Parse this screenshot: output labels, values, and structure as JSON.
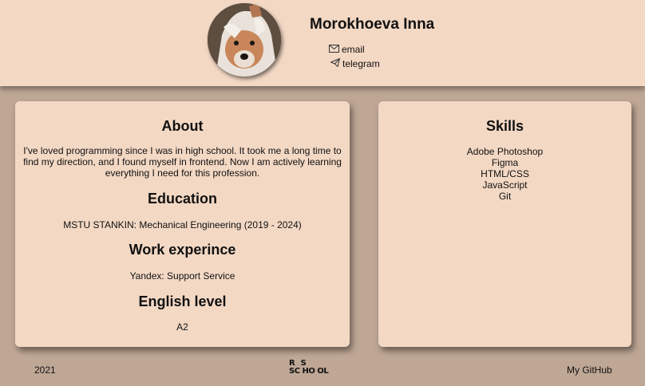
{
  "header": {
    "name": "Morokhoeva Inna",
    "email_label": "email",
    "telegram_label": "telegram"
  },
  "about": {
    "title": "About",
    "text": "I've loved programming since I was in high school. It took me a long time to find my direction, and I found myself in frontend. Now I am actively learning everything I need for this profession."
  },
  "education": {
    "title": "Education",
    "text": "MSTU STANKIN: Mechanical Engineering (2019 - 2024)"
  },
  "work": {
    "title": "Work experince",
    "text": "Yandex: Support Service"
  },
  "english": {
    "title": "English level",
    "text": "A2"
  },
  "skills": {
    "title": "Skills",
    "items": [
      "Adobe Photoshop",
      "Figma",
      "HTML/CSS",
      "JavaScript",
      "Git"
    ]
  },
  "footer": {
    "year": "2021",
    "logo_line1": "R  S",
    "logo_line2": "SC HO OL",
    "github_label": "My GitHub"
  },
  "colors": {
    "background": "#bfa795",
    "card": "#f3d8c4"
  }
}
